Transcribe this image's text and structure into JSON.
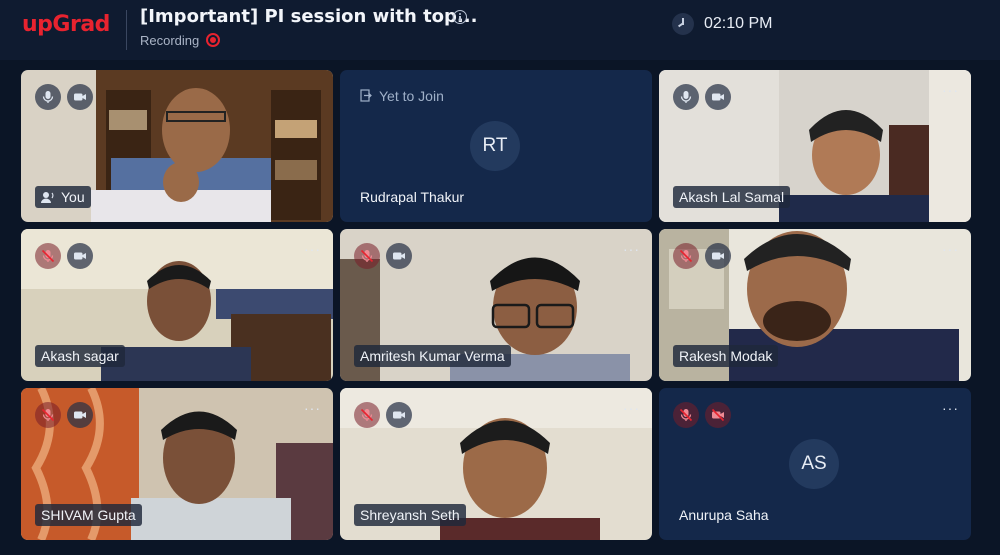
{
  "header": {
    "logo": "upGrad",
    "title": "[Important] PI session with top...",
    "recording_label": "Recording",
    "time": "02:10 PM"
  },
  "tiles": [
    {
      "name": "You",
      "video": true,
      "mic": "on",
      "cam": "on"
    },
    {
      "name": "Rudrapal Thakur",
      "initials": "RT",
      "status": "Yet to Join",
      "video": false
    },
    {
      "name": "Akash Lal Samal",
      "video": true,
      "mic": "on",
      "cam": "on"
    },
    {
      "name": "Akash sagar",
      "video": true,
      "mic": "off",
      "cam": "on"
    },
    {
      "name": "Amritesh Kumar Verma",
      "video": true,
      "mic": "off",
      "cam": "on"
    },
    {
      "name": "Rakesh Modak",
      "video": true,
      "mic": "off",
      "cam": "on"
    },
    {
      "name": "SHIVAM Gupta",
      "video": true,
      "mic": "off",
      "cam": "on"
    },
    {
      "name": "Shreyansh Seth",
      "video": true,
      "mic": "off",
      "cam": "on"
    },
    {
      "name": "Anurupa Saha",
      "initials": "AS",
      "video": false,
      "mic": "off",
      "cam": "off"
    }
  ],
  "more_label": "···",
  "colors": {
    "brand": "#e8232f",
    "background": "#0b1526",
    "tile": "#14284a"
  }
}
